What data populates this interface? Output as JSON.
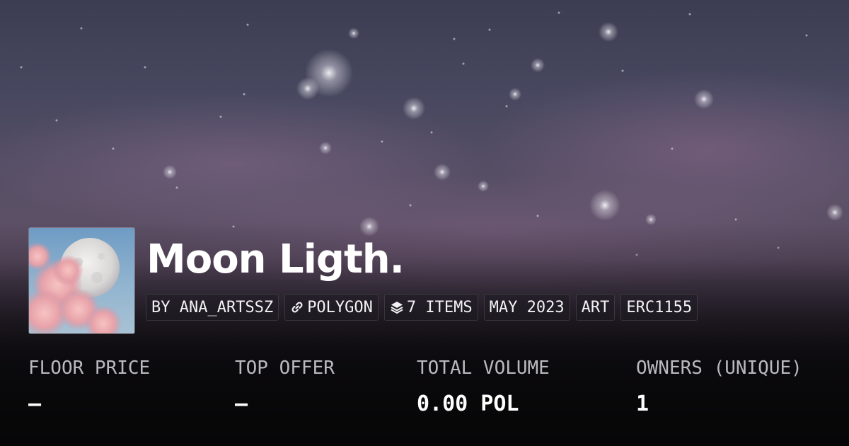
{
  "collection": {
    "title": "Moon Ligth.",
    "tags": {
      "creator": "BY ANA_ARTSSZ",
      "chain": "POLYGON",
      "items": "7 ITEMS",
      "date": "MAY 2023",
      "category": "ART",
      "standard": "ERC1155"
    },
    "icons": {
      "chain": "link-icon",
      "items": "layers-icon"
    }
  },
  "stats": {
    "floor_price": {
      "label": "FLOOR PRICE",
      "value": "—"
    },
    "top_offer": {
      "label": "TOP OFFER",
      "value": "—"
    },
    "total_volume": {
      "label": "TOTAL VOLUME",
      "value": "0.00 POL"
    },
    "owners": {
      "label": "OWNERS (UNIQUE)",
      "value": "1"
    }
  },
  "colors": {
    "sky_top": "#3c3c52",
    "sky_mid": "#5f4f66",
    "background_bottom": "#0c0b0d",
    "text_primary": "#ffffff",
    "text_secondary": "#b9b9bf"
  }
}
